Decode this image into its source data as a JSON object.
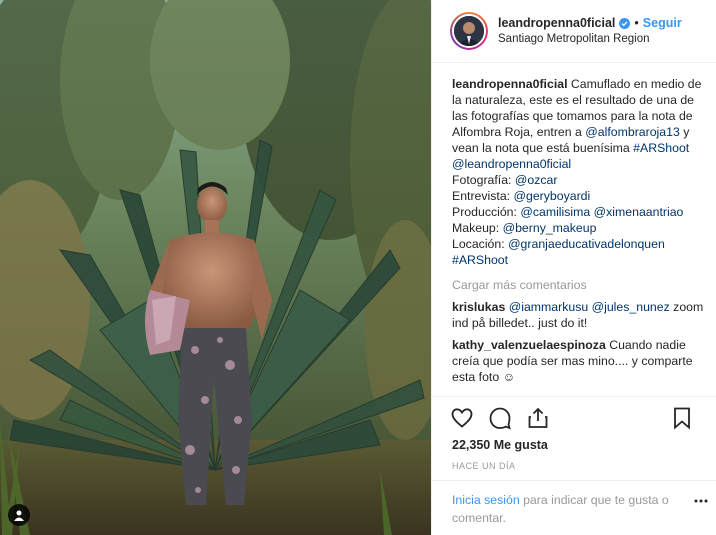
{
  "header": {
    "username": "leandropenna0ficial",
    "separator": "•",
    "follow_label": "Seguir",
    "location": "Santiago Metropolitan Region"
  },
  "caption": {
    "username": "leandropenna0ficial",
    "t1": " Camuflado en medio de la naturaleza, este es el resultado de una de las fotografías que tomamos para la nota de Alfombra Roja, entren a ",
    "m1": "@alfombraroja13",
    "t2": " y vean la nota que está buenísima ",
    "h1": "#ARShoot",
    "m2": "@leandropenna0ficial",
    "l1": "Fotografía: ",
    "m3": "@ozcar",
    "l2": "Entrevista: ",
    "m4": "@geryboyardi",
    "l3": "Producción: ",
    "m5": "@camilisima",
    "m6": "@ximenaantriao",
    "l4": "Makeup: ",
    "m7": "@berny_makeup",
    "l5": "Locación: ",
    "m8": "@granjaeducativadelonquen",
    "h2": "#ARShoot"
  },
  "load_more": "Cargar más comentarios",
  "comments": [
    {
      "user": "krislukas",
      "m1": "@iammarkusu",
      "m2": "@jules_nunez",
      "text": " zoom ind på billedet.. just do it!"
    },
    {
      "user": "kathy_valenzuelaespinoza",
      "text": " Cuando nadie creía que podía ser mas mino.... y comparte esta foto ☺"
    }
  ],
  "icons": {
    "like": "heart-icon",
    "comment": "comment-icon",
    "share": "share-icon",
    "save": "bookmark-icon",
    "more": "more-dots-icon",
    "tag": "user-tag-icon",
    "verified": "verified-badge-icon"
  },
  "likes": "22,350 Me gusta",
  "time": "HACE UN DÍA",
  "login": {
    "link": "Inicia sesión",
    "text": " para indicar que te gusta o comentar."
  },
  "colors": {
    "link_blue": "#3897f0",
    "mention": "#003569",
    "muted": "#999999",
    "text": "#262626"
  }
}
